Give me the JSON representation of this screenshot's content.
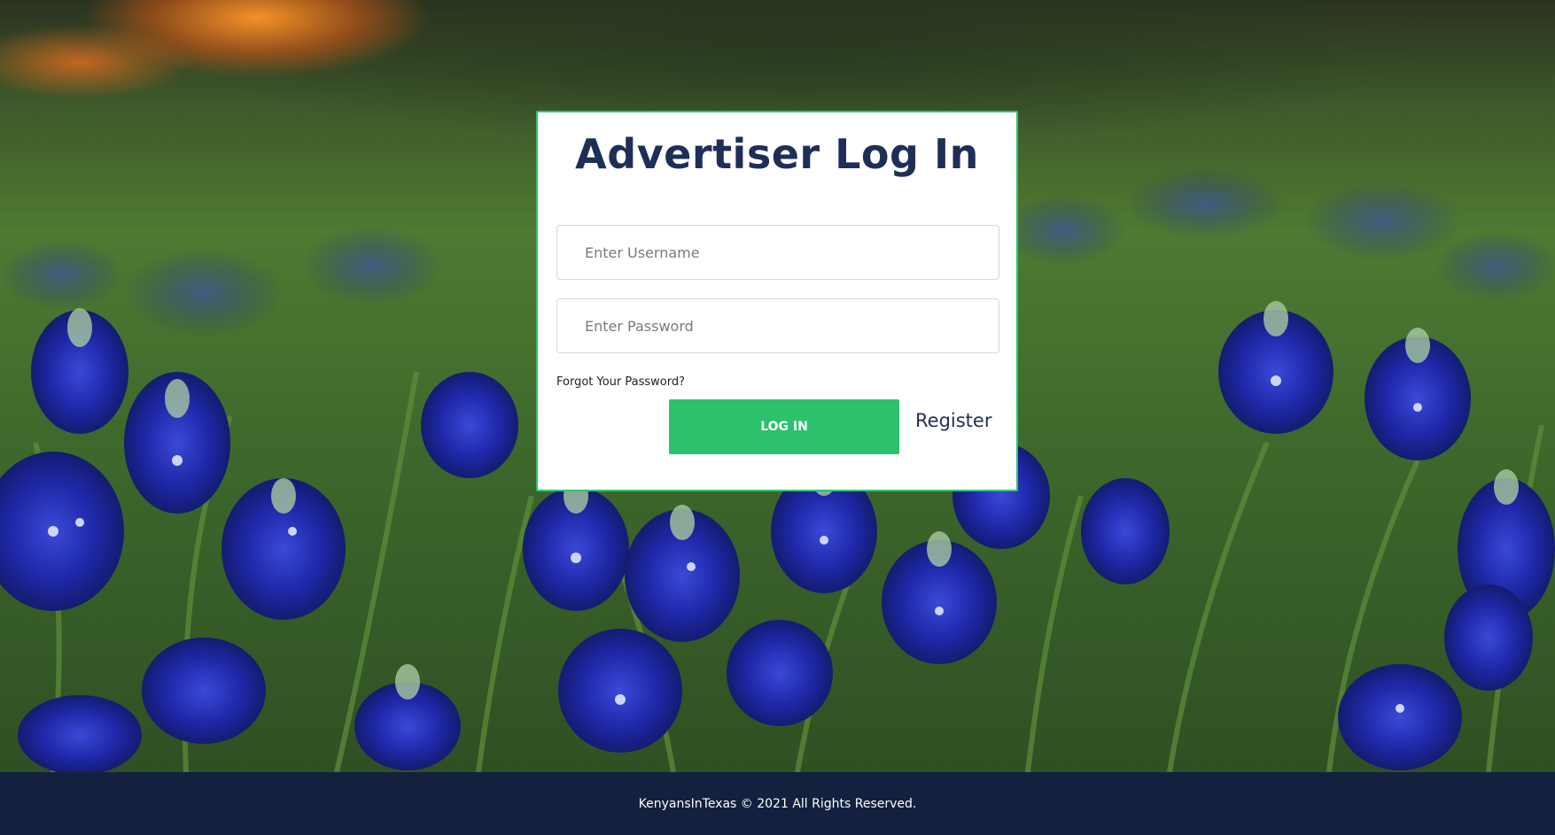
{
  "login_card": {
    "title": "Advertiser Log In",
    "username_placeholder": "Enter Username",
    "password_placeholder": "Enter Password",
    "forgot_password_label": "Forgot Your Password?",
    "login_button_label": "LOG IN",
    "register_label": "Register"
  },
  "footer": {
    "copyright": "KenyansInTexas © 2021 All Rights Reserved."
  },
  "colors": {
    "accent": "#2cc26d",
    "title": "#1e2f57",
    "footer_bg": "#13213e"
  }
}
